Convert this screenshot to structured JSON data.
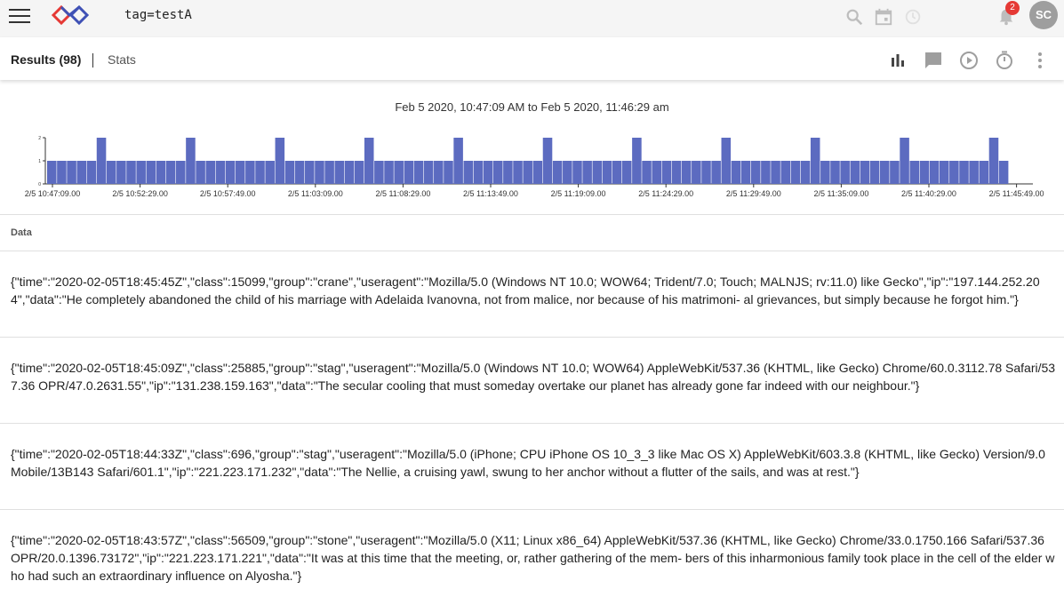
{
  "topbar": {
    "query": "tag=testA",
    "notification_count": "2",
    "avatar_initials": "SC",
    "icons": [
      "menu-icon",
      "logo-icon",
      "search-icon",
      "calendar-icon",
      "history-icon",
      "bell-icon"
    ]
  },
  "tabs": {
    "results_label": "Results (98)",
    "stats_label": "Stats",
    "actions": [
      "bar-chart-icon",
      "comment-icon",
      "play-icon",
      "timer-icon",
      "more-vert-icon"
    ]
  },
  "chart_data": {
    "type": "bar",
    "title": "Feb 5 2020, 10:47:09 AM to Feb 5 2020, 11:46:29 am",
    "y_ticks": [
      "0",
      "1",
      "2"
    ],
    "ylim": [
      0,
      2
    ],
    "categories": [
      "2/5 10:47:09.00",
      "2/5 10:52:29.00",
      "2/5 10:57:49.00",
      "2/5 11:03:09.00",
      "2/5 11:08:29.00",
      "2/5 11:13:49.00",
      "2/5 11:19:09.00",
      "2/5 11:24:29.00",
      "2/5 11:29:49.00",
      "2/5 11:35:09.00",
      "2/5 11:40:29.00",
      "2/5 11:45:49.00"
    ],
    "values": [
      1,
      1,
      1,
      1,
      1,
      2,
      1,
      1,
      1,
      1,
      1,
      1,
      1,
      1,
      2,
      1,
      1,
      1,
      1,
      1,
      1,
      1,
      1,
      2,
      1,
      1,
      1,
      1,
      1,
      1,
      1,
      1,
      2,
      1,
      1,
      1,
      1,
      1,
      1,
      1,
      1,
      2,
      1,
      1,
      1,
      1,
      1,
      1,
      1,
      1,
      2,
      1,
      1,
      1,
      1,
      1,
      1,
      1,
      1,
      2,
      1,
      1,
      1,
      1,
      1,
      1,
      1,
      1,
      2,
      1,
      1,
      1,
      1,
      1,
      1,
      1,
      1,
      2,
      1,
      1,
      1,
      1,
      1,
      1,
      1,
      1,
      2,
      1,
      1,
      1,
      1,
      1,
      1,
      1,
      1,
      2,
      1
    ],
    "bar_color": "#5c6bc0"
  },
  "data_section": {
    "header": "Data",
    "records": [
      "{\"time\":\"2020-02-05T18:45:45Z\",\"class\":15099,\"group\":\"crane\",\"useragent\":\"Mozilla/5.0 (Windows NT 10.0; WOW64; Trident/7.0; Touch; MALNJS; rv:11.0) like Gecko\",\"ip\":\"197.144.252.204\",\"data\":\"He completely abandoned the child of his marriage with Adelaida Ivanovna, not from malice, nor because of his matrimoni- al grievances, but simply because he forgot him.\"}",
      "{\"time\":\"2020-02-05T18:45:09Z\",\"class\":25885,\"group\":\"stag\",\"useragent\":\"Mozilla/5.0 (Windows NT 10.0; WOW64) AppleWebKit/537.36 (KHTML, like Gecko) Chrome/60.0.3112.78 Safari/537.36 OPR/47.0.2631.55\",\"ip\":\"131.238.159.163\",\"data\":\"The secular cooling that must someday overtake our planet has already gone far indeed with our neighbour.\"}",
      "{\"time\":\"2020-02-05T18:44:33Z\",\"class\":696,\"group\":\"stag\",\"useragent\":\"Mozilla/5.0 (iPhone; CPU iPhone OS 10_3_3 like Mac OS X) AppleWebKit/603.3.8 (KHTML, like Gecko) Version/9.0 Mobile/13B143 Safari/601.1\",\"ip\":\"221.223.171.232\",\"data\":\"The Nellie, a cruising yawl, swung to her anchor without a flutter of the sails, and was at rest.\"}",
      "{\"time\":\"2020-02-05T18:43:57Z\",\"class\":56509,\"group\":\"stone\",\"useragent\":\"Mozilla/5.0 (X11; Linux x86_64) AppleWebKit/537.36 (KHTML, like Gecko) Chrome/33.0.1750.166 Safari/537.36 OPR/20.0.1396.73172\",\"ip\":\"221.223.171.221\",\"data\":\"It was at this time that the meeting, or, rather gathering of the mem- bers of this inharmonious family took place in the cell of the elder who had such an extraordinary influence on Alyosha.\"}"
    ]
  }
}
